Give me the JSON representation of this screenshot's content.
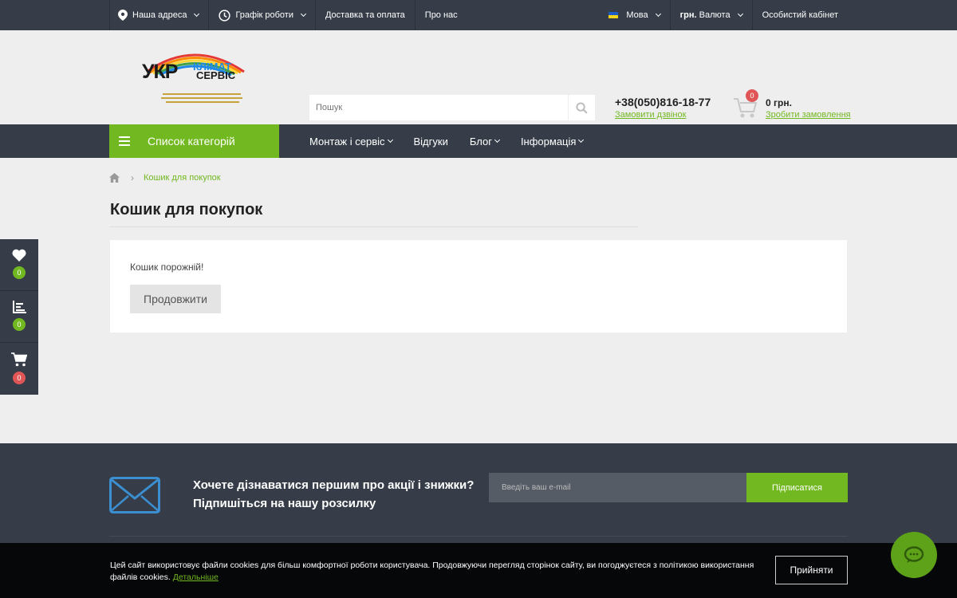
{
  "topbar": {
    "address": "Наша адреса",
    "schedule": "Графік роботи",
    "delivery": "Доставка та оплата",
    "about": "Про нас",
    "language": "Мова",
    "currency_code": "грн.",
    "currency_label": "Валюта",
    "account": "Особистий кабінет"
  },
  "header": {
    "logo_main": "УКР",
    "logo_top": "КЛІМАТ",
    "logo_bottom": "СЕРВІС",
    "search_placeholder": "Пошук",
    "phone": "+38(050)816-18-77",
    "callback": "Замовити дзвінок",
    "cart_count": "0",
    "cart_total": "0 грн.",
    "checkout": "Зробити замовлення"
  },
  "nav": {
    "categories": "Список категорій",
    "items": [
      {
        "label": "Монтаж і сервіс"
      },
      {
        "label": "Відгуки"
      },
      {
        "label": "Блог"
      },
      {
        "label": "Інформація"
      }
    ]
  },
  "breadcrumb": {
    "current": "Кошик для покупок"
  },
  "page": {
    "title": "Кошик для покупок",
    "empty_text": "Кошик порожній!",
    "continue": "Продовжити"
  },
  "side_widget": {
    "wishlist_count": "0",
    "compare_count": "0",
    "cart_count": "0"
  },
  "footer": {
    "subscribe_title": "Хочете дізнаватися першим про акції і знижки?",
    "subscribe_sub": "Підпишіться на нашу розсилку",
    "email_placeholder": "Введіть ваш e-mail",
    "subscribe_button": "Підписатися"
  },
  "cookie": {
    "text": "Цей сайт використовує файли cookies для більш комфортної роботи користувача. Продовжуючи перегляд сторінок сайту, ви погоджуєтеся з політикою використання файлів cookies.",
    "link": "Детальніше",
    "accept": "Прийняти"
  },
  "colors": {
    "accent": "#72b820",
    "dark": "#363d48",
    "badge": "#e05656"
  }
}
